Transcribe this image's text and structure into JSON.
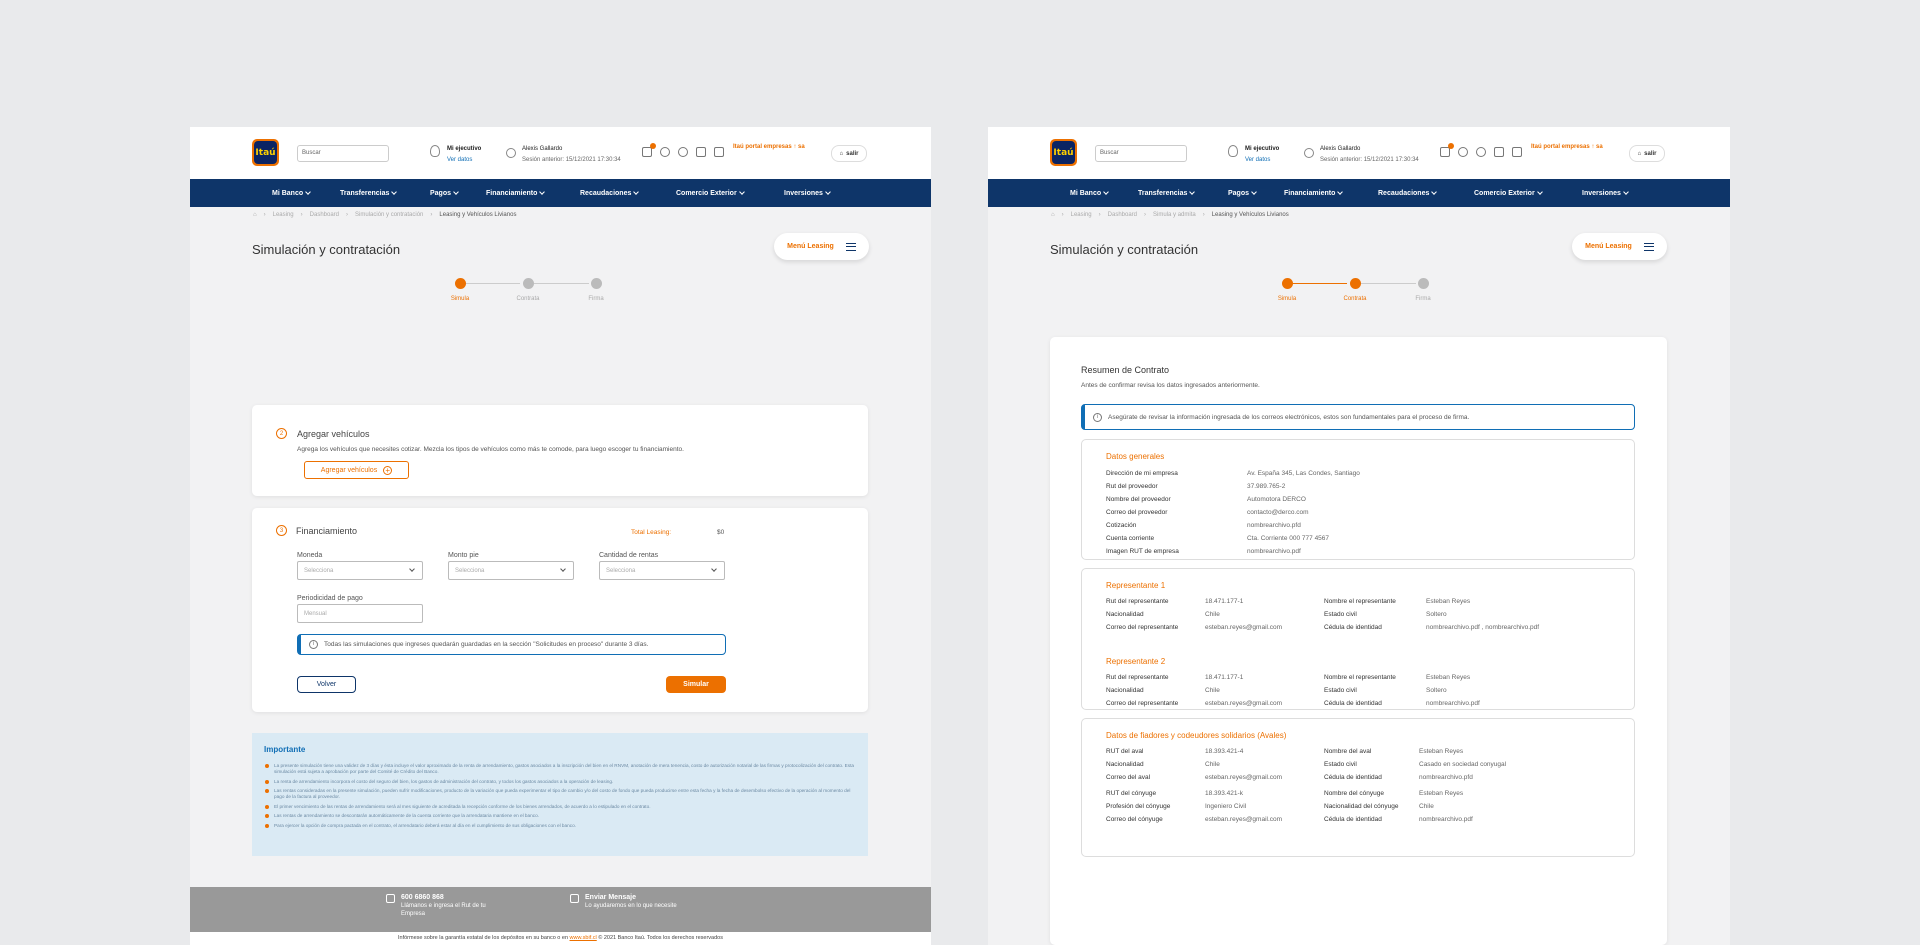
{
  "header": {
    "logo_text": "Itaú",
    "search_placeholder": "Buscar",
    "ejecutivo_title": "Mi ejecutivo",
    "ejecutivo_link": "Ver datos",
    "user_name": "Alexis Gallardo",
    "user_session": "Sesión anterior: 15/12/2021 17:30:34",
    "portal_label": "Itaú portal empresas ↑ sa",
    "logout_label": "salir",
    "notifications_badge": "1",
    "icons": [
      "briefcase-icon",
      "gear-icon",
      "bell-icon",
      "download-icon",
      "calendar-icon"
    ]
  },
  "nav": [
    "Mi Banco",
    "Transferencias",
    "Pagos",
    "Financiamiento",
    "Recaudaciones",
    "Comercio Exterior",
    "Inversiones"
  ],
  "breadcrumb_left": [
    "Leasing",
    "Dashboard",
    "Simulación y contratación",
    "Leasing y Vehículos Livianos"
  ],
  "breadcrumb_right": [
    "Leasing",
    "Dashboard",
    "Simula y admita",
    "Leasing y Vehículos Livianos"
  ],
  "page_title": "Simulación y contratación",
  "menu_leasing": "Menú Leasing",
  "steps": [
    "Simula",
    "Contrata",
    "Firma"
  ],
  "left": {
    "vehicles": {
      "number": "2",
      "title": "Agregar vehículos",
      "description": "Agrega los vehículos que necesites cotizar. Mezcla los tipos de vehículos como más te comode, para luego escoger tu financiamiento.",
      "button": "Agregar vehículos"
    },
    "financing": {
      "number": "3",
      "title": "Financiamiento",
      "total_label": "Total Leasing:",
      "total_value": "$0",
      "moneda_label": "Moneda",
      "moneda_placeholder": "Selecciona",
      "pie_label": "Monto pie",
      "pie_placeholder": "Selecciona",
      "rentas_label": "Cantidad de rentas",
      "rentas_placeholder": "Selecciona",
      "periodicidad_label": "Periodicidad de pago",
      "periodicidad_value": "Mensual",
      "info": "Todas las simulaciones que ingreses quedarán guardadas en la sección \"Solicitudes en proceso\" durante 3 días.",
      "back": "Volver",
      "simulate": "Simular"
    },
    "important": {
      "title": "Importante",
      "items": [
        "La presente simulación tiene una validez de 3 días y ésta incluye el valor aproximado de la renta de arrendamiento, gastos asociados a la inscripción del bien en el RNVM, anotación de mera tenencia, costo de autorización notarial de las firmas y protocolización del contrato. Esta simulación está sujeta a aprobación por parte del Comité de Crédito del Banco.",
        "La renta de arrendamiento incorpora el costo del seguro del bien, los gastos de administración del contrato, y todos los gastos asociados a la operación de leasing.",
        "Las rentas consideradas en la presente simulación, pueden sufrir modificaciones, producto de la variación que pueda experimentar el tipo de cambio y/o del costo de fondo que pueda producirse entre esta fecha y la fecha de desembolso efectivo de la operación al momento del pago de la factura al proveedor.",
        "El primer vencimiento de las rentas de arrendamiento será al mes siguiente de acreditada la recepción conforme de los bienes arrendados, de acuerdo a lo estipulado en el contrato.",
        "Las rentas de arrendamiento se descontarán automáticamente de la cuenta corriente que la arrendataria mantiene en el banco.",
        "Para ejercer la opción de compra pactada en el contrato, el arrendatario deberá estar al día en el cumplimiento de sus obligaciones con el banco."
      ]
    },
    "footer": {
      "phone": "600 6860 868",
      "phone_sub": "Llámanos e ingresa el Rut de tu Empresa",
      "message": "Enviar Mensaje",
      "message_sub": "Lo ayudaremos en lo que necesite",
      "legal_pre": "Infórmese sobre la garantía estatal de los depósitos en su banco o en",
      "legal_link": "www.sbif.cl",
      "legal_post": "© 2021 Banco Itaú. Todos los derechos reservados"
    }
  },
  "right": {
    "summary_title": "Resumen de Contrato",
    "summary_sub": "Antes de confirmar revisa los datos ingresados anteriormente.",
    "info": "Asegúrate de revisar la información ingresada de los correos electrónicos, estos son fundamentales para el proceso de firma.",
    "general": {
      "title": "Datos generales",
      "rows": [
        [
          "Dirección de mi empresa",
          "Av. España 345, Las Condes, Santiago"
        ],
        [
          "Rut del proveedor",
          "37.989.765-2"
        ],
        [
          "Nombre del proveedor",
          "Automotora DERCO"
        ],
        [
          "Correo del proveedor",
          "contacto@derco.com"
        ],
        [
          "Cotización",
          "nombrearchivo.pfd"
        ],
        [
          "Cuenta corriente",
          "Cta. Corriente 000 777 4567"
        ],
        [
          "Imagen RUT de empresa",
          "nombrearchivo.pdf"
        ]
      ]
    },
    "rep1": {
      "title": "Representante 1",
      "left": [
        [
          "Rut del representante",
          "18.471.177-1"
        ],
        [
          "Nacionalidad",
          "Chile"
        ],
        [
          "Correo del representante",
          "esteban.reyes@gmail.com"
        ]
      ],
      "right": [
        [
          "Nombre el representante",
          "Esteban Reyes"
        ],
        [
          "Estado civil",
          "Soltero"
        ],
        [
          "Cédula de identidad",
          "nombrearchivo.pdf , nombrearchivo.pdf"
        ]
      ]
    },
    "rep2": {
      "title": "Representante 2",
      "left": [
        [
          "Rut del representante",
          "18.471.177-1"
        ],
        [
          "Nacionalidad",
          "Chile"
        ],
        [
          "Correo del representante",
          "esteban.reyes@gmail.com"
        ]
      ],
      "right": [
        [
          "Nombre el representante",
          "Esteban Reyes"
        ],
        [
          "Estado civil",
          "Soltero"
        ],
        [
          "Cédula de identidad",
          "nombrearchivo.pdf"
        ]
      ]
    },
    "avales": {
      "title": "Datos de fiadores y codeudores solidarios (Avales)",
      "left": [
        [
          "RUT del aval",
          "18.393.421-4"
        ],
        [
          "Nacionalidad",
          "Chile"
        ],
        [
          "Correo del aval",
          "esteban.reyes@gmail.com"
        ],
        [
          "RUT del cónyuge",
          "18.393.421-k"
        ],
        [
          "Profesión del cónyuge",
          "Ingeniero Civil"
        ],
        [
          "Correo del cónyuge",
          "esteban.reyes@gmail.com"
        ]
      ],
      "right": [
        [
          "Nombre del aval",
          "Esteban Reyes"
        ],
        [
          "Estado civil",
          "Casado en sociedad conyugal"
        ],
        [
          "Cédula de identidad",
          "nombrearchivo.pfd"
        ],
        [
          "Nombre del cónyuge",
          "Esteban Reyes"
        ],
        [
          "Nacionalidad del cónyuge",
          "Chile"
        ],
        [
          "Cédula de identidad",
          "nombrearchivo.pdf"
        ]
      ]
    }
  },
  "colors": {
    "brand_orange": "#ec7000",
    "navy": "#0e3569",
    "info_blue": "#106eb5"
  }
}
